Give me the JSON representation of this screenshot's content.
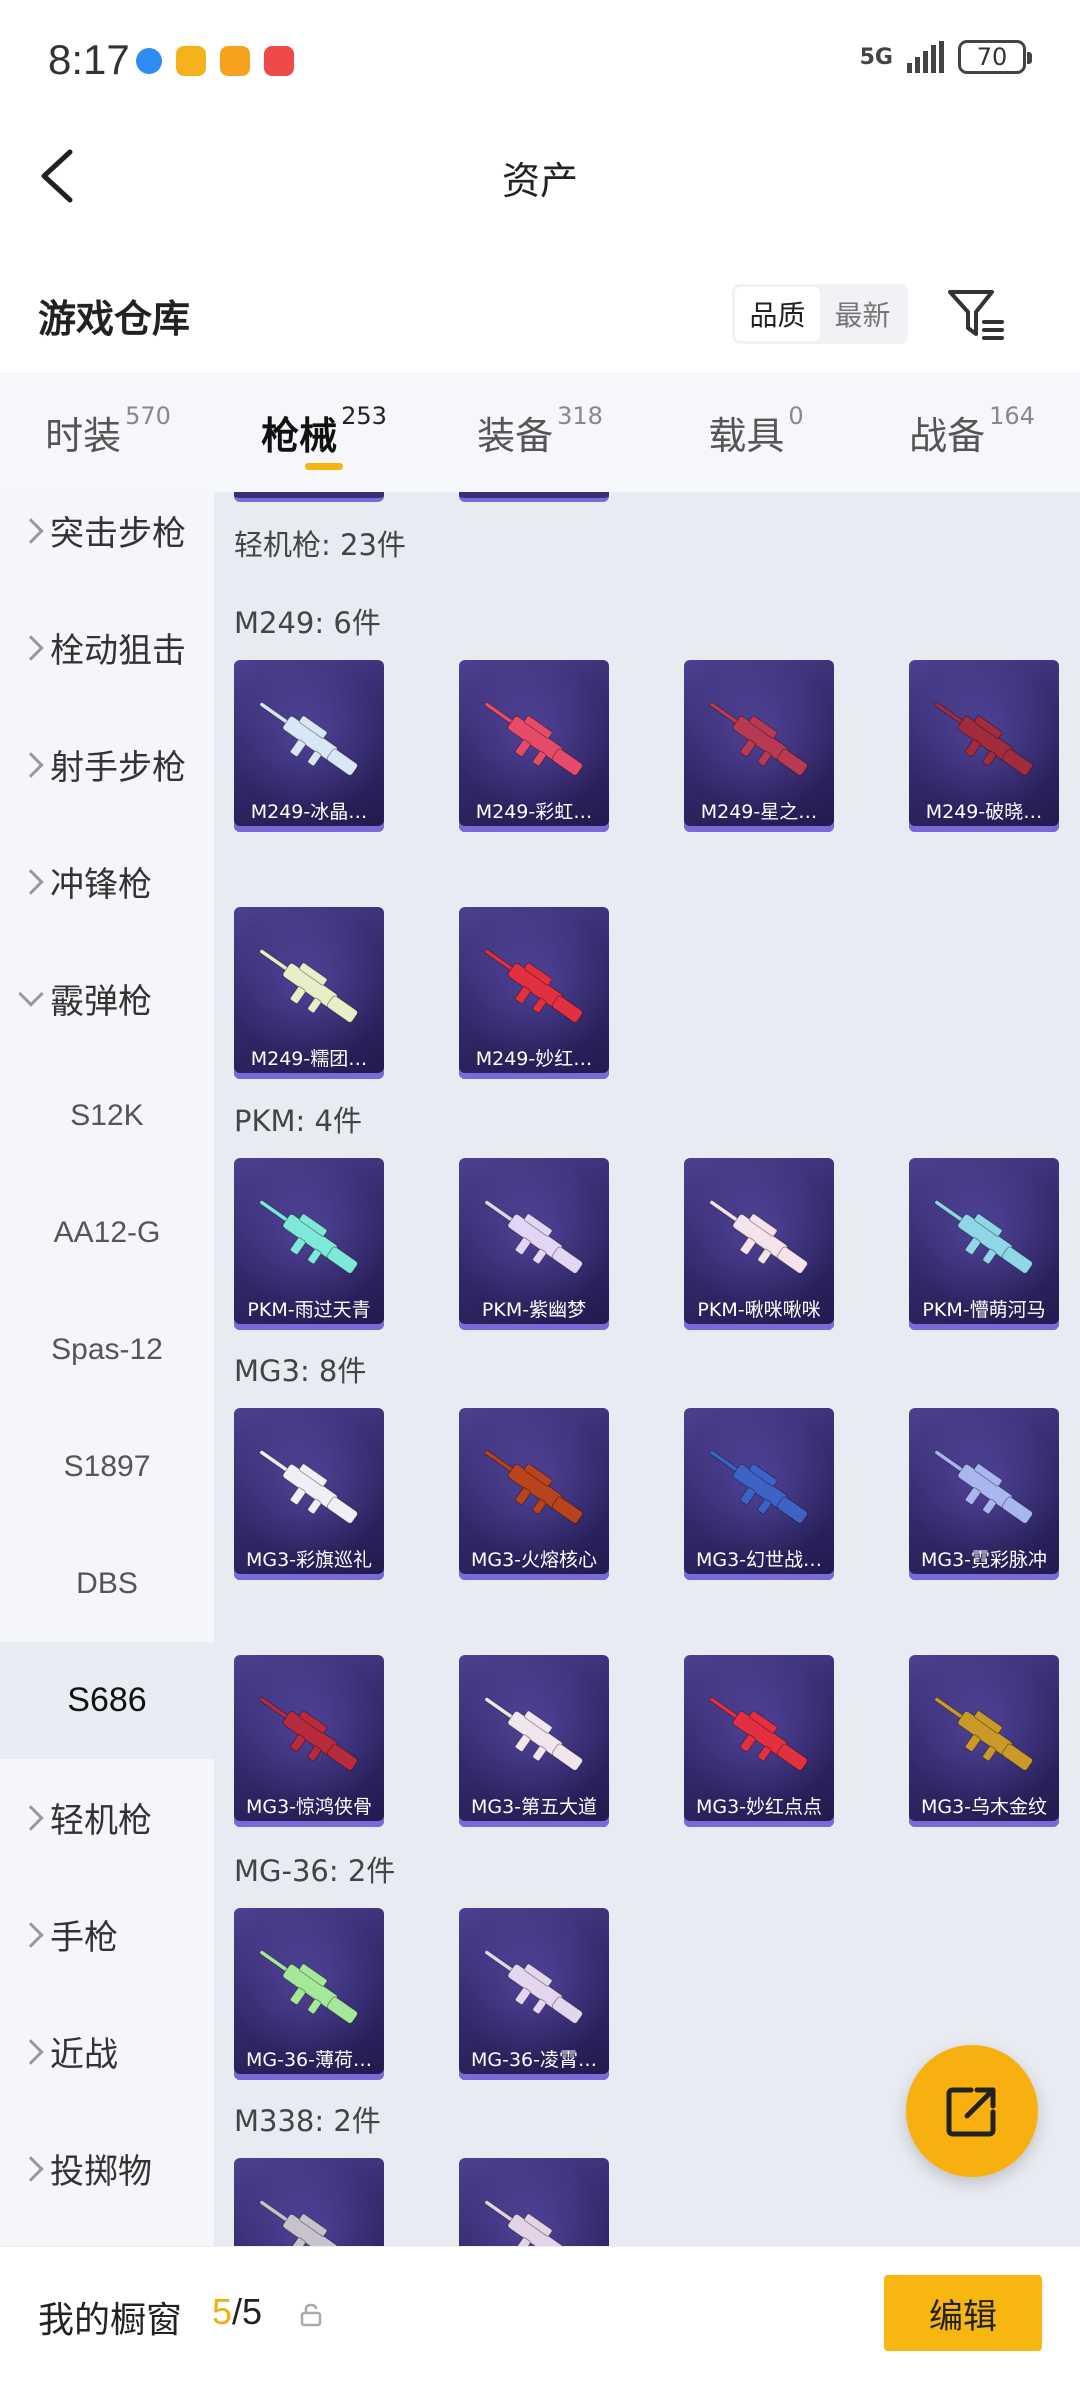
{
  "status_bar": {
    "time": "8:17",
    "network": "5G",
    "battery": "70"
  },
  "nav": {
    "title": "资产"
  },
  "warehouse": {
    "title": "游戏仓库",
    "sort_options": [
      "品质",
      "最新"
    ],
    "active_sort": 0
  },
  "tabs": [
    {
      "label": "时装",
      "count": "570"
    },
    {
      "label": "枪械",
      "count": "253",
      "active": true
    },
    {
      "label": "装备",
      "count": "318"
    },
    {
      "label": "载具",
      "count": "0"
    },
    {
      "label": "战备",
      "count": "164"
    }
  ],
  "sidebar": {
    "items": [
      {
        "label": "突击步枪",
        "type": "group"
      },
      {
        "label": "栓动狙击",
        "type": "group"
      },
      {
        "label": "射手步枪",
        "type": "group"
      },
      {
        "label": "冲锋枪",
        "type": "group"
      },
      {
        "label": "霰弹枪",
        "type": "group-open"
      },
      {
        "label": "S12K",
        "type": "sub"
      },
      {
        "label": "AA12-G",
        "type": "sub"
      },
      {
        "label": "Spas-12",
        "type": "sub"
      },
      {
        "label": "S1897",
        "type": "sub"
      },
      {
        "label": "DBS",
        "type": "sub"
      },
      {
        "label": "S686",
        "type": "sub",
        "selected": true
      },
      {
        "label": "轻机枪",
        "type": "group"
      },
      {
        "label": "手枪",
        "type": "group"
      },
      {
        "label": "近战",
        "type": "group"
      },
      {
        "label": "投掷物",
        "type": "group"
      }
    ]
  },
  "content": {
    "category_heading": "轻机枪: 23件",
    "groups": [
      {
        "heading": "M249: 6件",
        "items": [
          {
            "name": "M249-冰晶…",
            "color": "#d9e6f5"
          },
          {
            "name": "M249-彩虹…",
            "color": "#e64b6a"
          },
          {
            "name": "M249-星之…",
            "color": "#b83a52"
          },
          {
            "name": "M249-破晓…",
            "color": "#a02c3e"
          },
          {
            "name": "M249-糯团…",
            "color": "#e7eec8"
          },
          {
            "name": "M249-妙红…",
            "color": "#e23040"
          }
        ]
      },
      {
        "heading": "PKM: 4件",
        "items": [
          {
            "name": "PKM-雨过天青",
            "color": "#7ee8d9"
          },
          {
            "name": "PKM-紫幽梦",
            "color": "#e3d6f5"
          },
          {
            "name": "PKM-啾咪啾咪",
            "color": "#f5e3ec"
          },
          {
            "name": "PKM-懵萌河马",
            "color": "#8fd6e6"
          }
        ]
      },
      {
        "heading": "MG3: 8件",
        "items": [
          {
            "name": "MG3-彩旗巡礼",
            "color": "#eef0f5"
          },
          {
            "name": "MG3-火熔核心",
            "color": "#b8431c"
          },
          {
            "name": "MG3-幻世战…",
            "color": "#3e63c7"
          },
          {
            "name": "MG3-霓彩脉冲",
            "color": "#a9b7f0"
          },
          {
            "name": "MG3-惊鸿侠骨",
            "color": "#b82b3c"
          },
          {
            "name": "MG3-第五大道",
            "color": "#f2e6ee"
          },
          {
            "name": "MG3-妙红点点",
            "color": "#e23040"
          },
          {
            "name": "MG3-乌木金纹",
            "color": "#c99a2a"
          }
        ]
      },
      {
        "heading": "MG-36: 2件",
        "items": [
          {
            "name": "MG-36-薄荷…",
            "color": "#a5e89a"
          },
          {
            "name": "MG-36-凌霄…",
            "color": "#e3d6ee"
          }
        ]
      },
      {
        "heading": "M338: 2件",
        "items": [
          {
            "name": "",
            "color": "#c8c2cc"
          },
          {
            "name": "",
            "color": "#e2d4e6"
          }
        ]
      }
    ]
  },
  "bottom_bar": {
    "label": "我的橱窗",
    "used": "5",
    "total": "/5",
    "edit_label": "编辑"
  }
}
